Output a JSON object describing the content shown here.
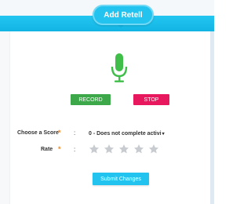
{
  "header": {
    "title": "Add Retell"
  },
  "recorder": {
    "mic_icon": "microphone-icon",
    "mic_color": "#3fbf4a",
    "record_label": "RECORD",
    "stop_label": "STOP",
    "record_color": "#3da84a",
    "stop_color": "#e8185f"
  },
  "form": {
    "score_label": "Choose a Score",
    "rate_label": "Rate",
    "required_mark": "*",
    "separator": ":",
    "score_selected": "0 - Does not complete activi",
    "caret": "▾",
    "rating": {
      "value": 0,
      "max": 5,
      "star_color": "#c8ccd0"
    },
    "submit_label": "Submit Changes"
  },
  "colors": {
    "accent": "#22c3ef"
  }
}
